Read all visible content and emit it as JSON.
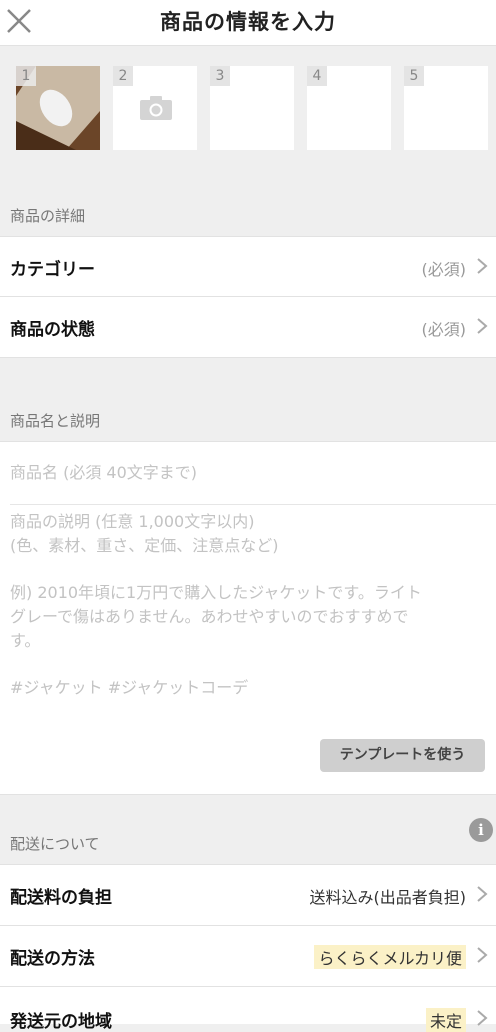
{
  "header": {
    "title": "商品の情報を入力",
    "close_icon": "close-icon"
  },
  "photos": [
    {
      "num": "1",
      "filled": true
    },
    {
      "num": "2",
      "icon": "camera-icon"
    },
    {
      "num": "3"
    },
    {
      "num": "4"
    },
    {
      "num": "5"
    }
  ],
  "details": {
    "section_label": "商品の詳細",
    "category": {
      "label": "カテゴリー",
      "value": "(必須)"
    },
    "condition": {
      "label": "商品の状態",
      "value": "(必須)"
    }
  },
  "name_desc": {
    "section_label": "商品名と説明",
    "name_placeholder": "商品名 (必須 40文字まで)",
    "desc_placeholder_lines": [
      "商品の説明 (任意 1,000文字以内)",
      "(色、素材、重さ、定価、注意点など)",
      "",
      "例) 2010年頃に1万円で購入したジャケットです。ライト",
      "グレーで傷はありません。あわせやすいのでおすすめで",
      "す。",
      "",
      "#ジャケット #ジャケットコーデ"
    ],
    "template_button": "テンプレートを使う"
  },
  "shipping": {
    "section_label": "配送について",
    "info_icon": "i",
    "fee": {
      "label": "配送料の負担",
      "value": "送料込み(出品者負担)"
    },
    "method": {
      "label": "配送の方法",
      "value": "らくらくメルカリ便"
    },
    "origin": {
      "label": "発送元の地域",
      "value": "未定"
    }
  }
}
